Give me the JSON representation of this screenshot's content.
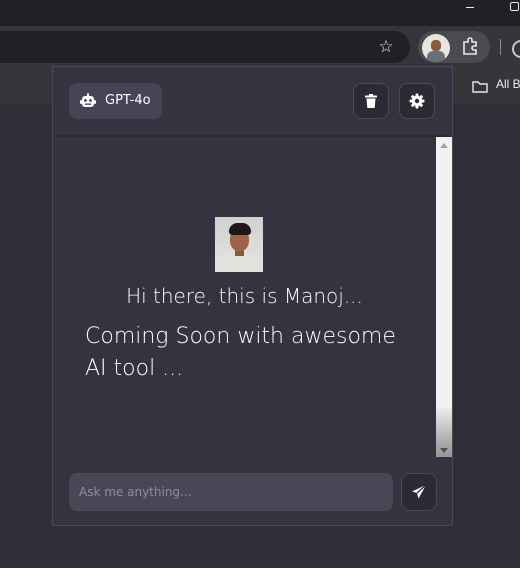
{
  "browser": {
    "bookmarks_label": "All Bo",
    "icons": [
      "star-icon",
      "extensions-icon",
      "folder-icon"
    ]
  },
  "popup": {
    "model_label": "GPT-4o",
    "icons": [
      "robot-icon",
      "trash-icon",
      "gear-icon",
      "send-icon"
    ],
    "greeting": "Hi there, this is Manoj...",
    "message": "Coming Soon with awesome AI tool ...",
    "input_placeholder": "Ask me anything...",
    "colors": {
      "panel": "#343441",
      "button": "#454556",
      "input": "#474756"
    }
  }
}
